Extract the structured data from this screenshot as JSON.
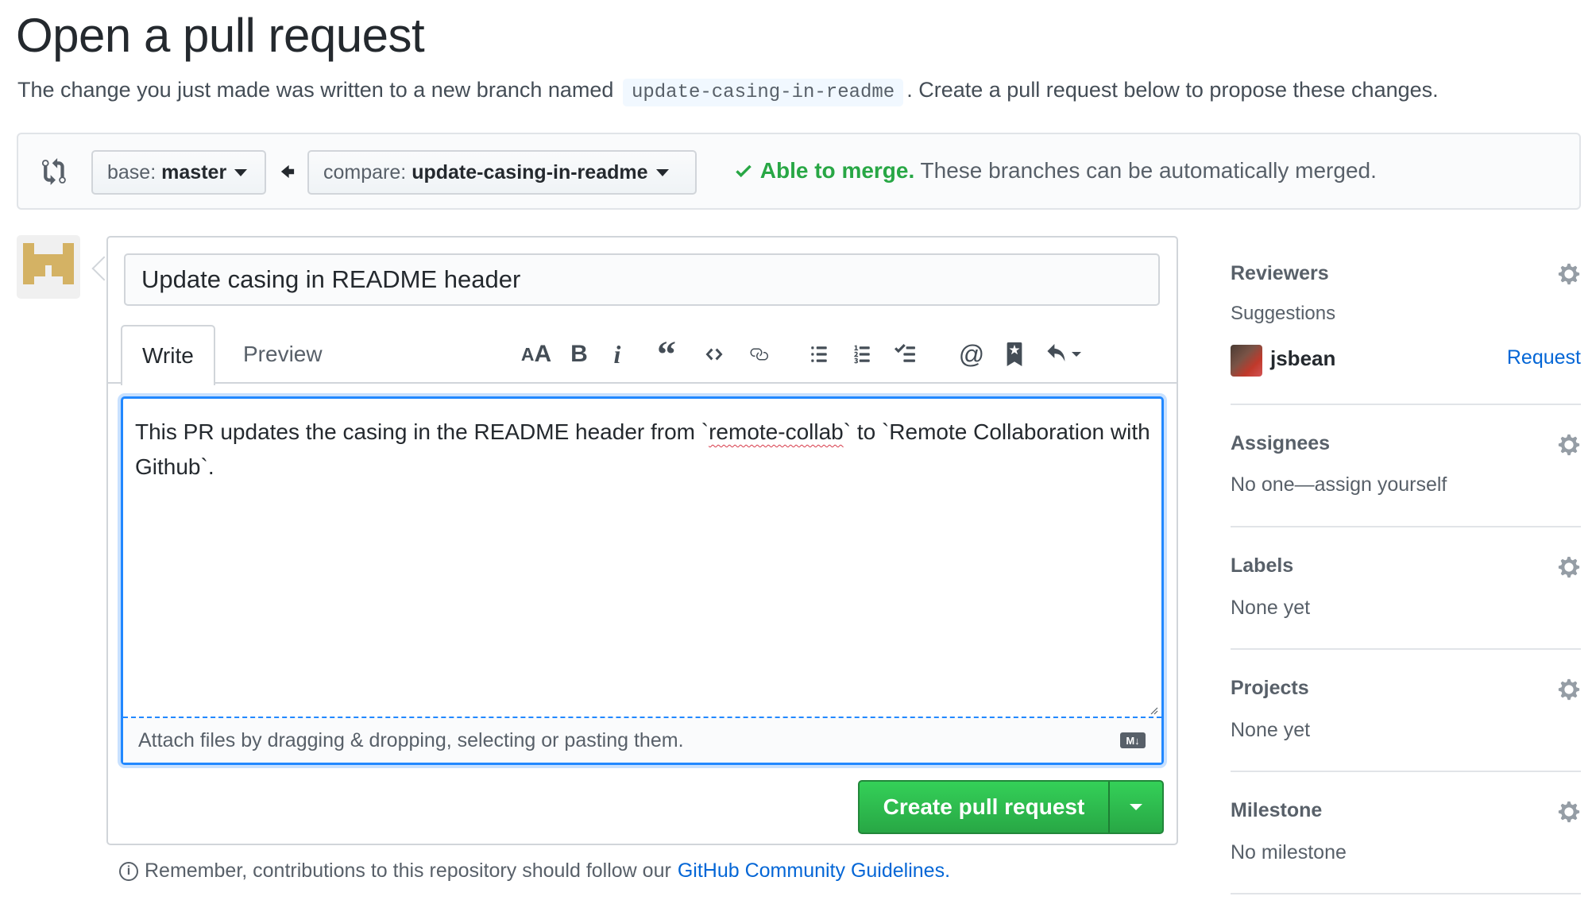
{
  "page": {
    "title": "Open a pull request",
    "intro_before": "The change you just made was written to a new branch named",
    "branch_name": "update-casing-in-readme",
    "intro_after": ". Create a pull request below to propose these changes."
  },
  "range": {
    "base_prefix": "base:",
    "base_value": "master",
    "compare_prefix": "compare:",
    "compare_value": "update-casing-in-readme",
    "merge_status": "Able to merge.",
    "merge_detail": "These branches can be automatically merged."
  },
  "composer": {
    "title_value": "Update casing in README header",
    "tabs": [
      {
        "label": "Write",
        "active": true
      },
      {
        "label": "Preview",
        "active": false
      }
    ],
    "toolbar_icons": [
      "text-size-icon",
      "bold-icon",
      "italic-icon",
      "quote-icon",
      "code-icon",
      "link-icon",
      "unordered-list-icon",
      "ordered-list-icon",
      "task-list-icon",
      "mention-icon",
      "saved-reply-icon",
      "reply-icon"
    ],
    "body_before": "This PR updates the casing in the README header from `",
    "body_misspelled": "remote-collab",
    "body_after": "` to `Remote Collaboration with Github`.",
    "attach_text": "Attach files by dragging & dropping, selecting or pasting them.",
    "markdown_badge": "M↓",
    "create_button": "Create pull request"
  },
  "footer": {
    "remember_text": "Remember, contributions to this repository should follow our",
    "guidelines_link": "GitHub Community Guidelines",
    "trailing": "."
  },
  "sidebar": {
    "reviewers": {
      "heading": "Reviewers",
      "suggestions_label": "Suggestions",
      "suggested_user": "jsbean",
      "request_label": "Request"
    },
    "assignees": {
      "heading": "Assignees",
      "value": "No one—assign yourself"
    },
    "labels": {
      "heading": "Labels",
      "value": "None yet"
    },
    "projects": {
      "heading": "Projects",
      "value": "None yet"
    },
    "milestone": {
      "heading": "Milestone",
      "value": "No milestone"
    }
  },
  "colors": {
    "accent_blue": "#0366d6",
    "success_green": "#28a745",
    "focus_blue": "#2188ff",
    "avatar_gold": "#d4b264"
  }
}
